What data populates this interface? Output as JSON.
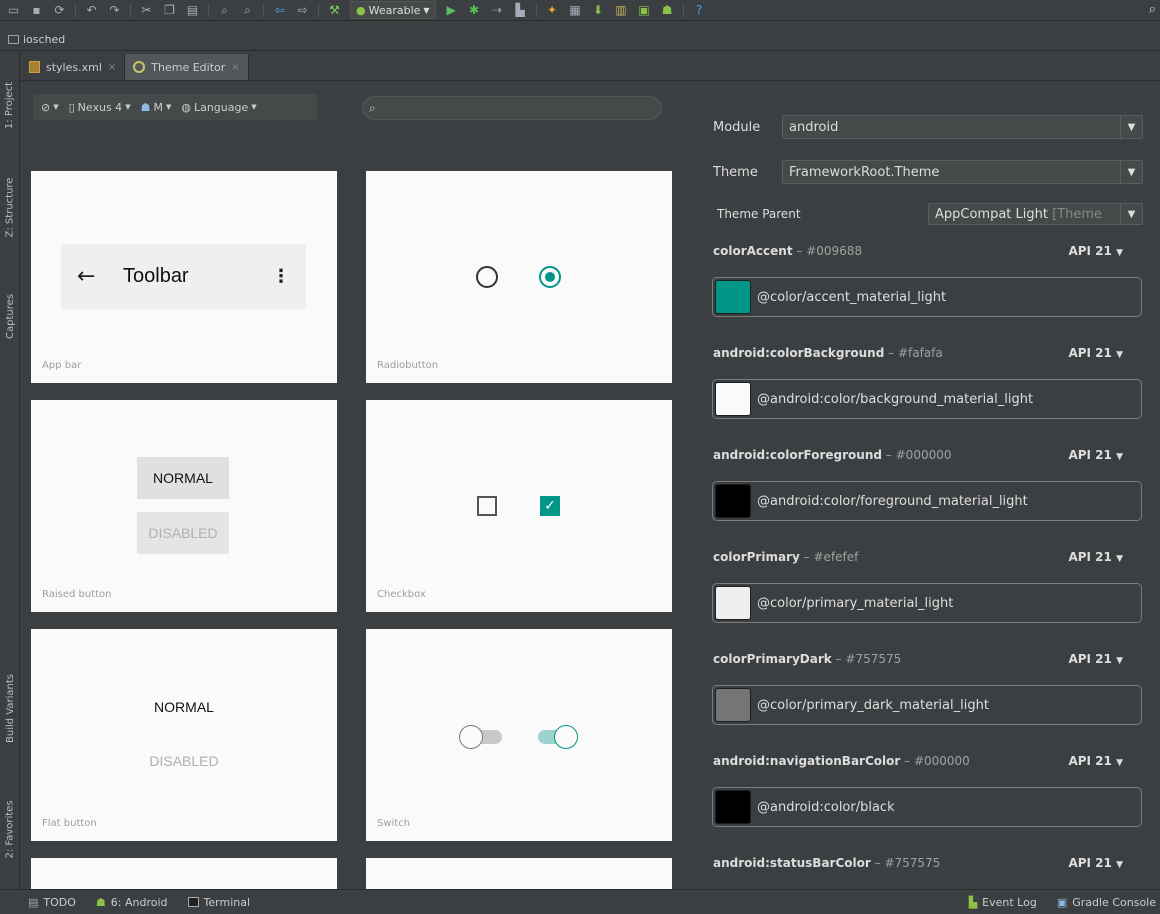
{
  "toolbar": {
    "run_config": "Wearable",
    "icons": [
      "open-icon",
      "save-icon",
      "sync-icon",
      "undo-icon",
      "redo-icon",
      "cut-icon",
      "copy-icon",
      "paste-icon",
      "find-icon",
      "replace-icon",
      "back-icon",
      "forward-icon",
      "make-icon",
      "run-icon",
      "debug-icon",
      "attach-icon",
      "coverage-icon",
      "profile-icon",
      "sdk-manager-icon",
      "avd-manager-icon",
      "device-monitor-icon",
      "android-icon",
      "help-icon",
      "search-icon"
    ]
  },
  "navbar": {
    "project": "iosched"
  },
  "side_tabs": {
    "project": "1: Project",
    "structure": "Z: Structure",
    "captures": "Captures",
    "build_variants": "Build Variants",
    "favorites": "2: Favorites"
  },
  "tabs": [
    {
      "label": "styles.xml",
      "close": "×"
    },
    {
      "label": "Theme Editor",
      "close": "×"
    }
  ],
  "preview": {
    "device": "Nexus 4",
    "api": "M",
    "language": "Language",
    "cards": {
      "appbar": {
        "label": "App bar",
        "title": "Toolbar",
        "back": "←",
        "more": "⋮"
      },
      "radio": {
        "label": "Radiobutton"
      },
      "raised": {
        "label": "Raised button",
        "normal": "NORMAL",
        "disabled": "DISABLED"
      },
      "checkbox": {
        "label": "Checkbox",
        "check": "✓"
      },
      "flat": {
        "label": "Flat button",
        "normal": "NORMAL",
        "disabled": "DISABLED"
      },
      "switch": {
        "label": "Switch"
      }
    }
  },
  "panel": {
    "module_label": "Module",
    "module_value": "android",
    "theme_label": "Theme",
    "theme_value": "FrameworkRoot.Theme",
    "parent_label": "Theme Parent",
    "parent_value": "AppCompat Light",
    "parent_suffix": "[Theme",
    "attributes": [
      {
        "name": "colorAccent",
        "hex": "#009688",
        "api": "API 21",
        "value": "@color/accent_material_light",
        "color": "#009688"
      },
      {
        "name": "android:colorBackground",
        "hex": "#fafafa",
        "api": "API 21",
        "value": "@android:color/background_material_light",
        "color": "#fafafa"
      },
      {
        "name": "android:colorForeground",
        "hex": "#000000",
        "api": "API 21",
        "value": "@android:color/foreground_material_light",
        "color": "#000000"
      },
      {
        "name": "colorPrimary",
        "hex": "#efefef",
        "api": "API 21",
        "value": "@color/primary_material_light",
        "color": "#efefef"
      },
      {
        "name": "colorPrimaryDark",
        "hex": "#757575",
        "api": "API 21",
        "value": "@color/primary_dark_material_light",
        "color": "#757575"
      },
      {
        "name": "android:navigationBarColor",
        "hex": "#000000",
        "api": "API 21",
        "value": "@android:color/black",
        "color": "#000000"
      },
      {
        "name": "android:statusBarColor",
        "hex": "#757575",
        "api": "API 21"
      }
    ]
  },
  "statusbar": {
    "todo": "TODO",
    "android": "6: Android",
    "terminal": "Terminal",
    "event_log": "Event Log",
    "gradle_console": "Gradle Console"
  },
  "colors": {
    "accent": "#009688",
    "ide_bg": "#3c3f41"
  }
}
